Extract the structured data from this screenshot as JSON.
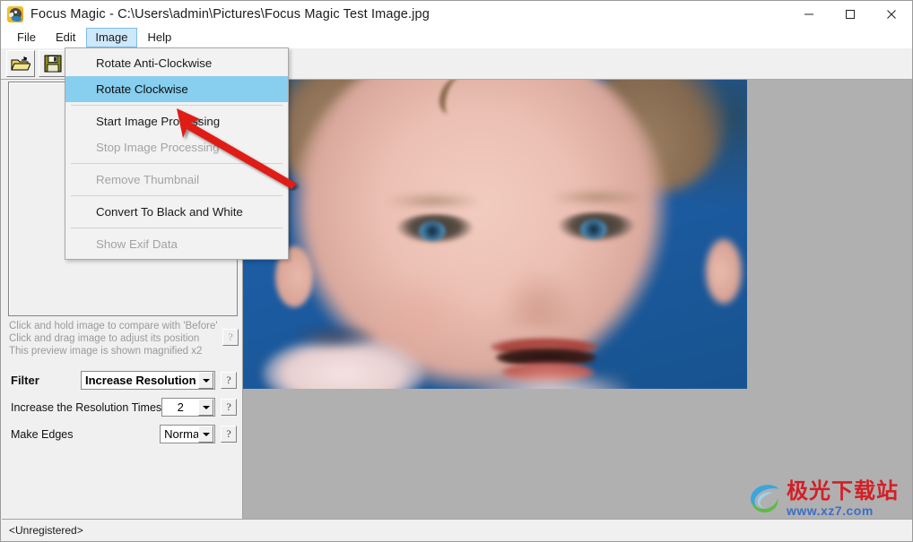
{
  "window": {
    "title": "Focus Magic - C:\\Users\\admin\\Pictures\\Focus Magic Test Image.jpg",
    "app_icon": "parrot-logo-icon",
    "controls": {
      "minimize": "minimize-icon",
      "maximize": "maximize-icon",
      "close": "close-icon"
    }
  },
  "menubar": {
    "items": [
      {
        "label": "File",
        "open": false
      },
      {
        "label": "Edit",
        "open": false
      },
      {
        "label": "Image",
        "open": true
      },
      {
        "label": "Help",
        "open": false
      }
    ]
  },
  "dropdown": {
    "owner": "Image",
    "items": [
      {
        "label": "Rotate Anti-Clockwise",
        "disabled": false,
        "selected": false,
        "separator_after": false
      },
      {
        "label": "Rotate Clockwise",
        "disabled": false,
        "selected": true,
        "separator_after": true
      },
      {
        "label": "Start Image Processing",
        "disabled": false,
        "selected": false,
        "separator_after": false
      },
      {
        "label": "Stop Image Processing",
        "disabled": true,
        "selected": false,
        "separator_after": true
      },
      {
        "label": "Remove Thumbnail",
        "disabled": true,
        "selected": false,
        "separator_after": true
      },
      {
        "label": "Convert To Black and White",
        "disabled": false,
        "selected": false,
        "separator_after": true
      },
      {
        "label": "Show Exif Data",
        "disabled": true,
        "selected": false,
        "separator_after": false
      }
    ]
  },
  "toolbar": {
    "buttons": [
      {
        "name": "open-file-button",
        "icon": "open-folder-icon",
        "enabled": true
      },
      {
        "name": "save-file-button",
        "icon": "floppy-save-icon",
        "enabled": true
      },
      {
        "name": "rotate-anticlockwise-button",
        "icon": "rotate-anticlockwise-icon",
        "enabled": true
      },
      {
        "name": "rotate-clockwise-button",
        "icon": "rotate-clockwise-icon",
        "enabled": true
      },
      {
        "name": "start-processing-button",
        "icon": "traffic-light-green-icon",
        "enabled": true
      },
      {
        "name": "stop-processing-button",
        "icon": "traffic-light-grey-icon",
        "enabled": false
      },
      {
        "name": "help-button",
        "icon": "question-mark-icon",
        "enabled": true
      }
    ]
  },
  "left_panel": {
    "hints": [
      "Click and hold image to compare with 'Before'",
      "Click and drag image to adjust its position",
      "This preview image is shown magnified x2"
    ],
    "hint_help_label": "?",
    "controls": [
      {
        "name": "filter",
        "label": "Filter",
        "value": "Increase Resolution",
        "help_label": "?"
      },
      {
        "name": "resolution-times",
        "label": "Increase the Resolution Times",
        "value": "2",
        "help_label": "?"
      },
      {
        "name": "make-edges",
        "label": "Make Edges",
        "value": "Normal",
        "help_label": "?"
      }
    ]
  },
  "statusbar": {
    "text": "<Unregistered>"
  },
  "watermark": {
    "chinese": "极光下载站",
    "url": "www.xz7.com"
  },
  "colors": {
    "menu_highlight": "#87ceef",
    "menu_open_bg": "#cde8fa",
    "canvas_bg": "#b0b0b0",
    "photo_bg_blue": "#1c5a9e",
    "arrow_red": "#e01b14",
    "watermark_red": "#d21f26",
    "watermark_blue": "#3c6fc4"
  }
}
